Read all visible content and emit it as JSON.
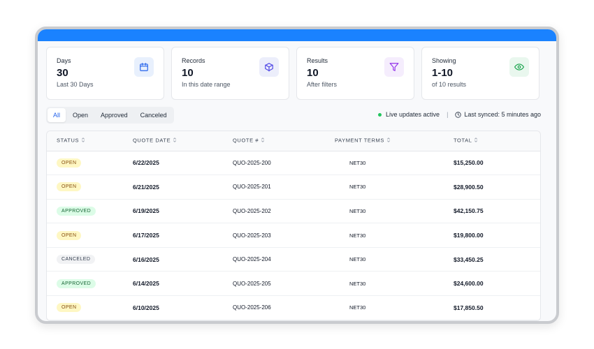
{
  "summary_cards": [
    {
      "title": "Days",
      "value": "30",
      "subtitle": "Last 30 Days",
      "icon": "calendar-icon"
    },
    {
      "title": "Records",
      "value": "10",
      "subtitle": "In this date range",
      "icon": "box-icon"
    },
    {
      "title": "Results",
      "value": "10",
      "subtitle": "After filters",
      "icon": "filter-icon"
    },
    {
      "title": "Showing",
      "value": "1-10",
      "subtitle": "of 10 results",
      "icon": "eye-icon"
    }
  ],
  "tabs": [
    {
      "label": "All",
      "active": true
    },
    {
      "label": "Open"
    },
    {
      "label": "Approved"
    },
    {
      "label": "Canceled"
    }
  ],
  "live_status": "Live updates active",
  "last_synced": "Last synced: 5 minutes ago",
  "table": {
    "columns": [
      "STATUS",
      "QUOTE DATE",
      "QUOTE #",
      "PAYMENT TERMS",
      "TOTAL"
    ],
    "rows": [
      {
        "status": "OPEN",
        "date": "6/22/2025",
        "quote": "QUO-2025-200",
        "terms": "NET30",
        "total": "$15,250.00"
      },
      {
        "status": "OPEN",
        "date": "6/21/2025",
        "quote": "QUO-2025-201",
        "terms": "NET30",
        "total": "$28,900.50"
      },
      {
        "status": "APPROVED",
        "date": "6/19/2025",
        "quote": "QUO-2025-202",
        "terms": "NET30",
        "total": "$42,150.75"
      },
      {
        "status": "OPEN",
        "date": "6/17/2025",
        "quote": "QUO-2025-203",
        "terms": "NET30",
        "total": "$19,800.00"
      },
      {
        "status": "CANCELED",
        "date": "6/16/2025",
        "quote": "QUO-2025-204",
        "terms": "NET30",
        "total": "$33,450.25"
      },
      {
        "status": "APPROVED",
        "date": "6/14/2025",
        "quote": "QUO-2025-205",
        "terms": "NET30",
        "total": "$24,600.00"
      },
      {
        "status": "OPEN",
        "date": "6/10/2025",
        "quote": "QUO-2025-206",
        "terms": "NET30",
        "total": "$17,850.50"
      }
    ]
  },
  "colors": {
    "accent": "#1a82ff",
    "live": "#22c55e"
  }
}
